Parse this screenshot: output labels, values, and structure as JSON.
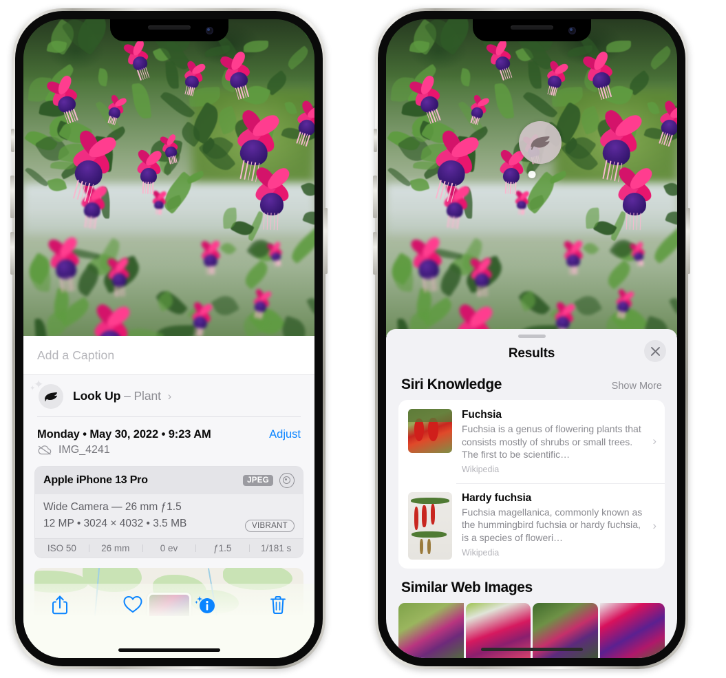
{
  "left_phone": {
    "caption": {
      "placeholder": "Add a Caption",
      "value": ""
    },
    "look_up": {
      "label": "Look Up",
      "dash": "–",
      "subject": "Plant",
      "chevron": "›",
      "icon": "leaf-icon",
      "sparkle": "✦"
    },
    "date_row": {
      "date": "Monday • May 30, 2022 • 9:23 AM",
      "adjust_label": "Adjust"
    },
    "file_row": {
      "filename": "IMG_4241",
      "icon": "icloud-slash-icon"
    },
    "exif": {
      "device": "Apple iPhone 13 Pro",
      "format_badge": "JPEG",
      "lens_icon": "camera-lens-icon",
      "lens_line": "Wide Camera — 26 mm ƒ1.5",
      "size_line": "12 MP • 3024 × 4032 • 3.5 MB",
      "style_badge": "VIBRANT",
      "stats": [
        "ISO 50",
        "26 mm",
        "0 ev",
        "ƒ1.5",
        "1/181 s"
      ]
    },
    "toolbar": {
      "share_icon": "share-icon",
      "favorite_icon": "heart-icon",
      "info_icon": "info-sparkle-icon",
      "delete_icon": "trash-icon"
    }
  },
  "right_phone": {
    "visual_lookup_badge": {
      "icon": "leaf-icon"
    },
    "results": {
      "title": "Results",
      "close_icon": "close-icon",
      "siri_knowledge": {
        "title": "Siri Knowledge",
        "show_more": "Show More",
        "items": [
          {
            "title": "Fuchsia",
            "description": "Fuchsia is a genus of flowering plants that consists mostly of shrubs or small trees. The first to be scientific…",
            "source": "Wikipedia",
            "chevron": "›"
          },
          {
            "title": "Hardy fuchsia",
            "description": "Fuchsia magellanica, commonly known as the hummingbird fuchsia or hardy fuchsia, is a species of floweri…",
            "source": "Wikipedia",
            "chevron": "›"
          }
        ]
      },
      "similar_web_images": {
        "title": "Similar Web Images",
        "count": 4
      }
    }
  },
  "colors": {
    "accent_blue": "#0a84ff",
    "sheet_bg": "#f2f2f5",
    "card_bg": "#ffffff",
    "secondary_text": "#8a8a90",
    "badge_gray": "#9b9ba1"
  }
}
